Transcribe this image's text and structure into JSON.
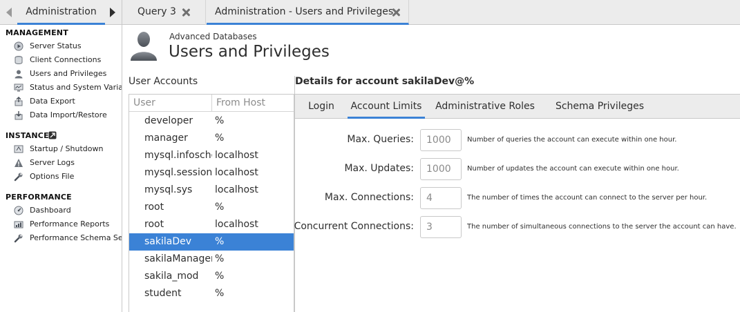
{
  "sidebar": {
    "tab_title": "Administration",
    "management": {
      "heading": "MANAGEMENT",
      "items": [
        {
          "label": "Server Status",
          "icon": "play-circle-icon"
        },
        {
          "label": "Client Connections",
          "icon": "plug-icon"
        },
        {
          "label": "Users and Privileges",
          "icon": "user-icon"
        },
        {
          "label": "Status and System Variables",
          "icon": "monitor-icon"
        },
        {
          "label": "Data Export",
          "icon": "export-icon"
        },
        {
          "label": "Data Import/Restore",
          "icon": "import-icon"
        }
      ]
    },
    "instance": {
      "heading": "INSTANCE",
      "items": [
        {
          "label": "Startup / Shutdown",
          "icon": "power-icon"
        },
        {
          "label": "Server Logs",
          "icon": "warning-icon"
        },
        {
          "label": "Options File",
          "icon": "wrench-icon"
        }
      ]
    },
    "performance": {
      "heading": "PERFORMANCE",
      "items": [
        {
          "label": "Dashboard",
          "icon": "dashboard-icon"
        },
        {
          "label": "Performance Reports",
          "icon": "reports-icon"
        },
        {
          "label": "Performance Schema Setup",
          "icon": "wrench-icon"
        }
      ]
    }
  },
  "tabs": {
    "query": "Query 3",
    "admin": "Administration - Users and Privileges"
  },
  "header": {
    "subtitle": "Advanced Databases",
    "title": "Users and Privileges"
  },
  "user_accounts": {
    "title": "User Accounts",
    "columns": {
      "user": "User",
      "host": "From Host"
    },
    "selected_index": 7,
    "rows": [
      {
        "user": "developer",
        "host": "%"
      },
      {
        "user": "manager",
        "host": "%"
      },
      {
        "user": "mysql.infoschema",
        "host": "localhost"
      },
      {
        "user": "mysql.session",
        "host": "localhost"
      },
      {
        "user": "mysql.sys",
        "host": "localhost"
      },
      {
        "user": "root",
        "host": "%"
      },
      {
        "user": "root",
        "host": "localhost"
      },
      {
        "user": "sakilaDev",
        "host": "%"
      },
      {
        "user": "sakilaManager",
        "host": "%"
      },
      {
        "user": "sakila_mod",
        "host": "%"
      },
      {
        "user": "student",
        "host": "%"
      }
    ]
  },
  "details": {
    "title": "Details for account sakilaDev@%",
    "tabs": [
      "Login",
      "Account Limits",
      "Administrative Roles",
      "Schema Privileges"
    ],
    "active_tab": "Account Limits",
    "limits": [
      {
        "label": "Max. Queries:",
        "value": "1000",
        "description": "Number of queries the account can execute within one hour."
      },
      {
        "label": "Max. Updates:",
        "value": "1000",
        "description": "Number of updates the account can execute within one hour."
      },
      {
        "label": "Max. Connections:",
        "value": "4",
        "description": "The number of times the account can connect to the server per hour."
      },
      {
        "label": "Concurrent Connections:",
        "value": "3",
        "description": "The number of simultaneous connections to the server the account can have."
      }
    ]
  },
  "colors": {
    "accent": "#3b82d6",
    "chrome": "#ececec"
  }
}
